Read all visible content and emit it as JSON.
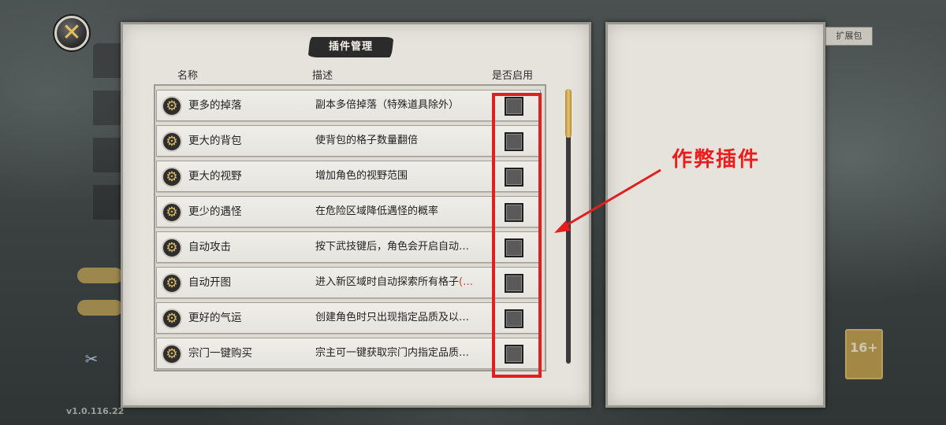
{
  "window": {
    "title": "插件管理",
    "version": "v1.0.116.22"
  },
  "columns": {
    "name": "名称",
    "description": "描述",
    "enabled": "是否启用"
  },
  "plugins": [
    {
      "name": "更多的掉落",
      "description": "副本多倍掉落（特殊道具除外）",
      "enabled": false
    },
    {
      "name": "更大的背包",
      "description": "使背包的格子数量翻倍",
      "enabled": false
    },
    {
      "name": "更大的视野",
      "description": "增加角色的视野范围",
      "enabled": false
    },
    {
      "name": "更少的遇怪",
      "description": "在危险区域降低遇怪的概率",
      "enabled": false
    },
    {
      "name": "自动攻击",
      "description": "按下武技键后，角色会开启自动…",
      "enabled": false
    },
    {
      "name": "自动开图",
      "description": "进入新区域时自动探索所有格子",
      "description_suffix": "(…",
      "enabled": false
    },
    {
      "name": "更好的气运",
      "description": "创建角色时只出现指定品质及以…",
      "enabled": false
    },
    {
      "name": "宗门一键购买",
      "description": "宗主可一键获取宗门内指定品质…",
      "enabled": false
    }
  ],
  "annotation": {
    "label": "作弊插件",
    "color": "#e11f1f"
  },
  "background": {
    "right_panel_tab": "扩展包",
    "age_badge": "16+"
  },
  "icons": {
    "close": "close-x-icon",
    "plugin": "gear-icon"
  },
  "colors": {
    "paper": "#e5e3dc",
    "accent_gold": "#d9b966",
    "annotation_red": "#e11f1f"
  }
}
